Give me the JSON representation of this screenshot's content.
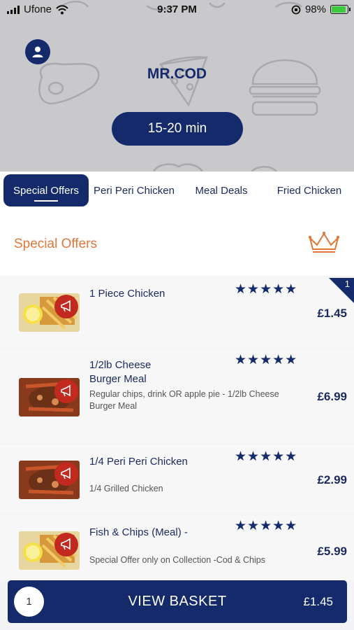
{
  "status_bar": {
    "carrier": "Ufone",
    "time": "9:37 PM",
    "battery": "98%"
  },
  "header": {
    "title": "MR.COD",
    "delivery_time": "15-20 min"
  },
  "tabs": [
    {
      "label": "Special Offers",
      "active": true
    },
    {
      "label": "Peri Peri Chicken",
      "active": false
    },
    {
      "label": "Meal Deals",
      "active": false
    },
    {
      "label": "Fried Chicken",
      "active": false
    }
  ],
  "section": {
    "title": "Special Offers",
    "icon": "crown-icon"
  },
  "items": [
    {
      "name": "1 Piece Chicken",
      "description": "",
      "price": "£1.45",
      "rating": 5,
      "stars": "★★★★★",
      "in_basket": "1"
    },
    {
      "name": "1/2lb Cheese Burger Meal",
      "description": "Regular chips, drink OR apple pie -  1/2lb Cheese Burger Meal",
      "price": "£6.99",
      "rating": 5,
      "stars": "★★★★★"
    },
    {
      "name": "1/4 Peri Peri Chicken",
      "description": "1/4 Grilled Chicken",
      "price": "£2.99",
      "rating": 5,
      "stars": "★★★★★"
    },
    {
      "name": "Fish & Chips (Meal) -",
      "description": "Special Offer only on Collection -Cod & Chips",
      "price": "£5.99",
      "rating": 5,
      "stars": "★★★★★"
    }
  ],
  "basket": {
    "quantity": "1",
    "label": "VIEW BASKET",
    "total": "£1.45"
  },
  "colors": {
    "primary": "#142a6b",
    "accent": "#e0763a",
    "badge": "#c22a1f",
    "header_bg": "#c9c9cc"
  }
}
